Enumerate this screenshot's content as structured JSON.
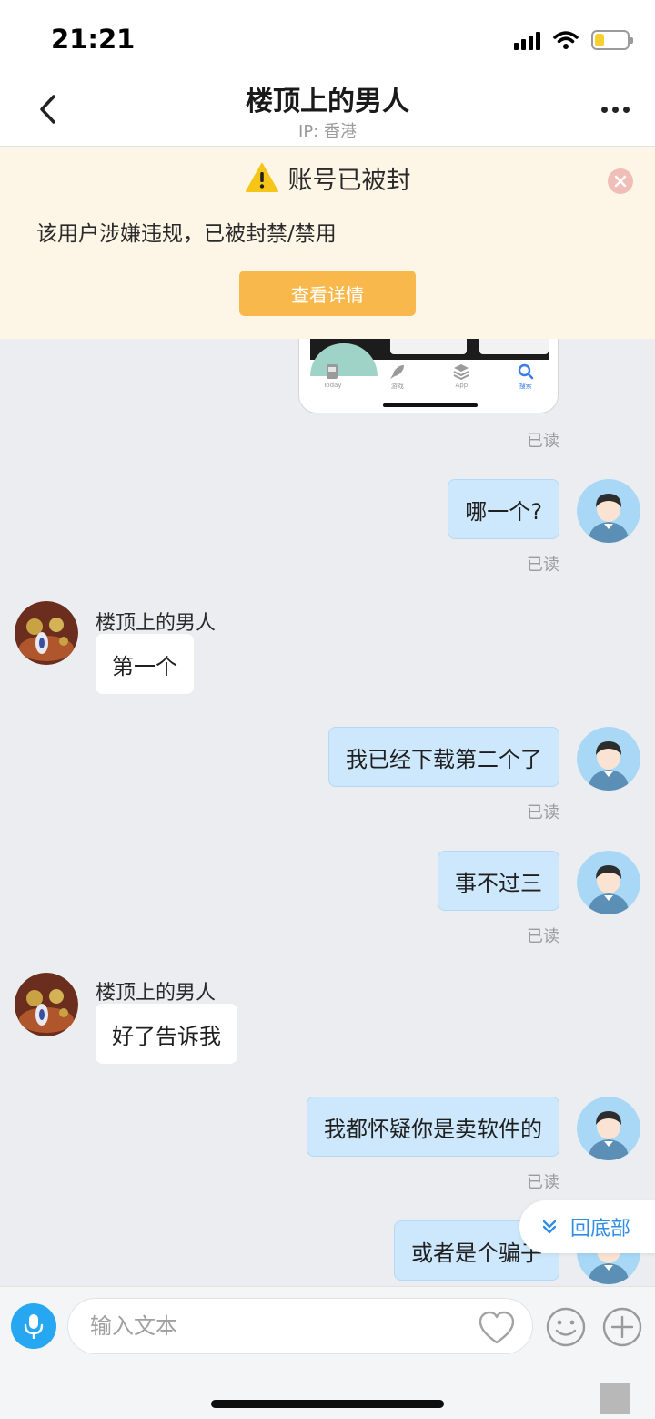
{
  "status_bar": {
    "time": "21:21",
    "battery_level": 0.3,
    "battery_color": "#f7cf2f"
  },
  "nav": {
    "title": "楼顶上的男人",
    "subtitle": "IP: 香港",
    "back_icon": "chevron-left-icon",
    "more_icon": "more-dots-icon"
  },
  "ban_banner": {
    "title": "账号已被封",
    "description": "该用户涉嫌违规，已被封禁/禁用",
    "button_label": "查看详情",
    "warning_color": "#f5c518",
    "button_color": "#f9b84c"
  },
  "screenshot_card": {
    "tabs": [
      {
        "label": "Today",
        "icon": "today-icon",
        "active": false
      },
      {
        "label": "游戏",
        "icon": "rocket-icon",
        "active": false
      },
      {
        "label": "App",
        "icon": "layers-icon",
        "active": false
      },
      {
        "label": "搜索",
        "icon": "search-icon",
        "active": true
      }
    ]
  },
  "read_label": "已读",
  "messages": [
    {
      "direction": "sent",
      "text": "哪一个?",
      "status": "已读"
    },
    {
      "direction": "received",
      "sender": "楼顶上的男人",
      "text": "第一个"
    },
    {
      "direction": "sent",
      "text": "我已经下载第二个了",
      "status": "已读"
    },
    {
      "direction": "sent",
      "text": "事不过三",
      "status": "已读"
    },
    {
      "direction": "received",
      "sender": "楼顶上的男人",
      "text": "好了告诉我"
    },
    {
      "direction": "sent",
      "text": "我都怀疑你是卖软件的",
      "status": "已读"
    },
    {
      "direction": "sent",
      "text": "或者是个骗子"
    }
  ],
  "scroll_to_bottom": {
    "label": "回底部",
    "icon": "double-chevron-down-icon"
  },
  "input_bar": {
    "placeholder": "输入文本",
    "voice_icon": "microphone-icon",
    "like_icon": "heart-icon",
    "emoji_icon": "smiley-icon",
    "more_icon": "plus-icon"
  },
  "colors": {
    "sent_bubble": "#cde8fc",
    "received_bubble": "#ffffff",
    "accent": "#27a7f2",
    "background": "#ebedf0"
  }
}
